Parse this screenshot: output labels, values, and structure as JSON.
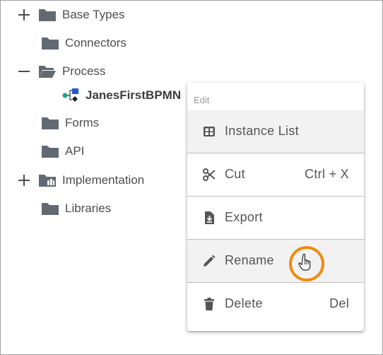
{
  "tree": {
    "items": [
      {
        "label": "Base Types",
        "expander": "plus"
      },
      {
        "label": "Connectors"
      },
      {
        "label": "Process",
        "expander": "minus"
      },
      {
        "label": "JanesFirstBPMN"
      },
      {
        "label": "Forms"
      },
      {
        "label": "API"
      },
      {
        "label": "Implementation",
        "expander": "plus"
      },
      {
        "label": "Libraries"
      }
    ]
  },
  "context_menu": {
    "header": "Edit",
    "items": [
      {
        "label": "Instance List",
        "icon": "table-icon",
        "shortcut": ""
      },
      {
        "label": "Cut",
        "icon": "scissors-icon",
        "shortcut": "Ctrl + X"
      },
      {
        "label": "Export",
        "icon": "file-download-icon",
        "shortcut": ""
      },
      {
        "label": "Rename",
        "icon": "pencil-icon",
        "shortcut": ""
      },
      {
        "label": "Delete",
        "icon": "trash-icon",
        "shortcut": "Del"
      }
    ]
  },
  "colors": {
    "folder": "#616a73",
    "highlight_ring": "#ef8a0f",
    "menu_hover": "#f2f2f2",
    "bpmn_blue": "#1e5bd8",
    "bpmn_teal": "#17a589"
  }
}
